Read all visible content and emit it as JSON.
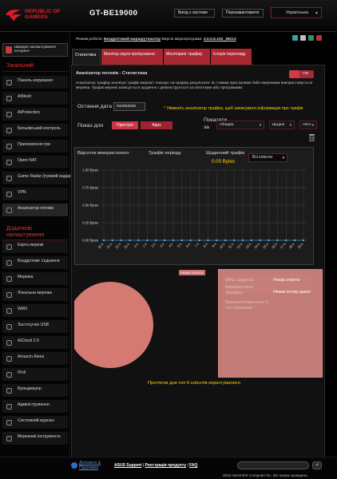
{
  "header": {
    "brand_line1": "REPUBLIC OF",
    "brand_line2": "GAMERS",
    "model": "GT-BE19000",
    "logout": "Вихід з системи",
    "reboot": "Перезавантажити",
    "language": "Українська"
  },
  "fw": {
    "mode_label": "Режим роботи:",
    "mode_value": "Бездротовий маршрутизатор",
    "fw_label": "Версія мікропрограми:",
    "fw_value": "3.0.0.6.102_36213"
  },
  "sidebar": {
    "qis": "Швидке налаштування Інтернет",
    "general_title": "Загальний",
    "general": [
      "Панель керування",
      "AiMesh",
      "AiProtection",
      "Батьківський контроль",
      "Прискорення гри",
      "Open NAT",
      "Game Radar (Ігровий радар)",
      "VPN",
      "Аналізатор потоків"
    ],
    "advanced_title": "Додаткові налаштування",
    "advanced": [
      "Карта мережі",
      "Бездротове з'єднання",
      "Мережа",
      "Локальна мережа",
      "WAN",
      "Застосунки USB",
      "AiCloud 2.0",
      "Amazon Alexa",
      "IPv6",
      "Брандмауер",
      "Адміністрування",
      "Системний журнал",
      "Мережеві інструменти"
    ]
  },
  "tabs": [
    "Статистика",
    "Монітор смуги пропускання",
    "Моніторинг трафіку",
    "Історія перегляду"
  ],
  "panel": {
    "title": "Аналізатор потоків - Статистика",
    "toggle": "ON",
    "description": "Аналізатор трафіку аналізує трафік мережі і показує на графіку результати: як і якими пристроями і/або мережами використовується мережа. Трафік мережі записується щоденно і демонструється за клієнтами або програмами.",
    "date_label": "Остання дата",
    "date_value": "04/29/2025",
    "date_note": "* Увімкніть аналізатор трафіку, щоб записувати інформацію про трафік",
    "show_by_label": "Показ для",
    "show_by": [
      "Пристрої",
      "Apps"
    ],
    "show_label": "Показати за",
    "selects": [
      "Обидва",
      "Щодня",
      "Авто"
    ]
  },
  "chart_data": {
    "type": "line",
    "title": "",
    "header_labels": [
      "Відсоток використаного",
      "Трафік періоду",
      "Щоденний трафік"
    ],
    "period_value": "0.00 Bytes",
    "client_select": "Всі клієнти",
    "y_ticks": [
      "1.00 Bytes",
      "0.75 Bytes",
      "0.50 Bytes",
      "0.25 Bytes",
      "0.00 Bytes"
    ],
    "ylim": [
      0,
      1
    ],
    "x": [
      "20 h",
      "21 h",
      "22 h",
      "23 h",
      "0 h",
      "1 h",
      "2 h",
      "3 h",
      "4 h",
      "5 h",
      "6 h",
      "7 h",
      "8 h",
      "9 h",
      "10 h",
      "11 h",
      "12 h",
      "13 h",
      "14 h",
      "15 h",
      "16 h",
      "17 h",
      "18 h",
      "19 h"
    ],
    "series": [
      {
        "values": [
          0,
          0,
          0,
          0,
          0,
          0,
          0,
          0,
          0,
          0,
          0,
          0,
          0,
          0,
          0,
          0,
          0,
          0,
          0,
          0,
          0,
          0,
          0,
          0
        ]
      }
    ],
    "grid": true,
    "colors": {
      "line": "#4aa8e8",
      "grid": "#555555"
    }
  },
  "pie": {
    "tag": "Немає клієнта",
    "color": "#d47a73"
  },
  "legend": {
    "mac_label": "MAC-адреса:",
    "mac_value": "Немає клієнта",
    "used_label": "Використано трафіку:",
    "used_value": "Немає потоку даних",
    "top5_label": "Використовується 5 топ-програм :"
  },
  "top5_note": "Протягом дня топ-5 клієнтів користувалися",
  "footer": {
    "help": "Допомога & Підтримка",
    "support": "ASUS Support",
    "register": "Реєстрація продукту",
    "faq": "FAQ",
    "copyright": "2024 ASUSTeK Computer Inc. Всі права захищено."
  }
}
